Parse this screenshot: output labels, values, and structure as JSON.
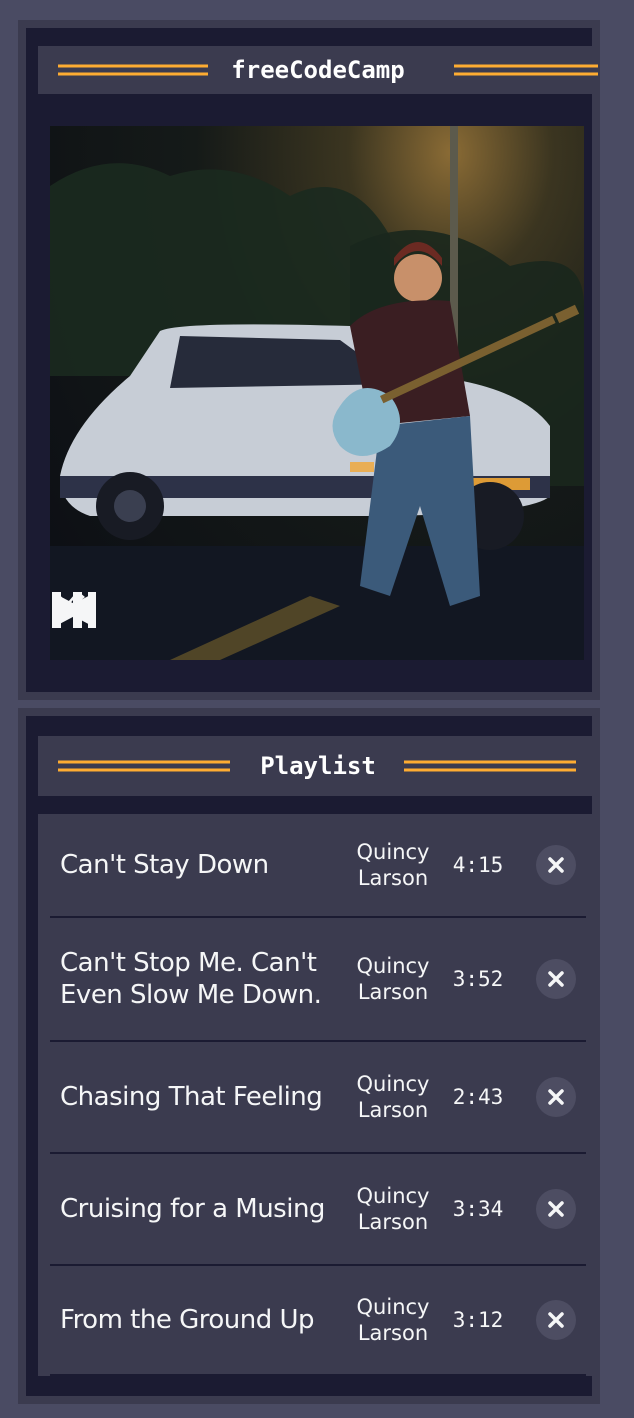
{
  "player": {
    "title": "freeCodeCamp",
    "controls": [
      {
        "name": "previous-button",
        "icon": "skip-back-icon"
      },
      {
        "name": "play-button",
        "icon": "play-icon"
      },
      {
        "name": "pause-button",
        "icon": "pause-icon"
      },
      {
        "name": "next-button",
        "icon": "skip-forward-icon"
      },
      {
        "name": "shuffle-button",
        "icon": "shuffle-icon"
      }
    ]
  },
  "playlist": {
    "title": "Playlist",
    "songs": [
      {
        "title": "Can't Stay Down",
        "artist": "Quincy Larson",
        "duration": "4:15"
      },
      {
        "title": "Can't Stop Me. Can't Even Slow Me Down.",
        "artist": "Quincy Larson",
        "duration": "3:52"
      },
      {
        "title": "Chasing That Feeling",
        "artist": "Quincy Larson",
        "duration": "2:43"
      },
      {
        "title": "Cruising for a Musing",
        "artist": "Quincy Larson",
        "duration": "3:34"
      },
      {
        "title": "From the Ground Up",
        "artist": "Quincy Larson",
        "duration": "3:12"
      }
    ]
  },
  "colors": {
    "background": "#4a4b63",
    "panel": "#1b1b32",
    "bar": "#3b3b4f",
    "accent": "#feac32",
    "text": "#f5f6f7"
  }
}
